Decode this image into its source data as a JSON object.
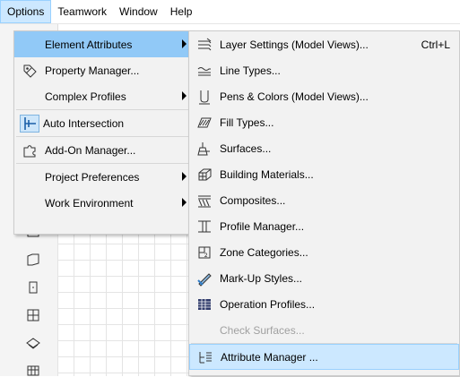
{
  "menubar": {
    "items": [
      {
        "label": "Options",
        "active": true
      },
      {
        "label": "Teamwork"
      },
      {
        "label": "Window"
      },
      {
        "label": "Help"
      }
    ]
  },
  "options_menu": {
    "items": [
      {
        "label": "Element Attributes",
        "icon": "none",
        "submenu": true,
        "highlighted": true
      },
      {
        "label": "Property Manager...",
        "icon": "tag-icon"
      },
      {
        "label": "Complex Profiles",
        "icon": "none",
        "submenu": true
      },
      {
        "label": "Auto Intersection",
        "icon": "intersection-icon",
        "checked": true
      },
      {
        "label": "Add-On Manager...",
        "icon": "puzzle-icon"
      },
      {
        "label": "Project Preferences",
        "icon": "none",
        "submenu": true
      },
      {
        "label": "Work Environment",
        "icon": "none",
        "submenu": true
      }
    ]
  },
  "attributes_submenu": {
    "items": [
      {
        "label": "Layer Settings (Model Views)...",
        "icon": "layers-icon",
        "shortcut": "Ctrl+L"
      },
      {
        "label": "Line Types...",
        "icon": "line-types-icon"
      },
      {
        "label": "Pens & Colors (Model Views)...",
        "icon": "pen-icon"
      },
      {
        "label": "Fill Types...",
        "icon": "fill-icon"
      },
      {
        "label": "Surfaces...",
        "icon": "surfaces-icon"
      },
      {
        "label": "Building Materials...",
        "icon": "building-materials-icon"
      },
      {
        "label": "Composites...",
        "icon": "composites-icon"
      },
      {
        "label": "Profile Manager...",
        "icon": "profile-icon"
      },
      {
        "label": "Zone Categories...",
        "icon": "zone-icon"
      },
      {
        "label": "Mark-Up Styles...",
        "icon": "markup-icon"
      },
      {
        "label": "Operation Profiles...",
        "icon": "operation-icon"
      },
      {
        "label": "Check Surfaces...",
        "icon": "none",
        "disabled": true
      },
      {
        "label": "Attribute Manager ...",
        "icon": "attribute-manager-icon",
        "selected": true
      }
    ]
  },
  "colors": {
    "highlight": "#91c9f7",
    "menu_bg": "#f2f2f2",
    "selection": "#cce8ff",
    "disabled_text": "#a0a0a0"
  }
}
